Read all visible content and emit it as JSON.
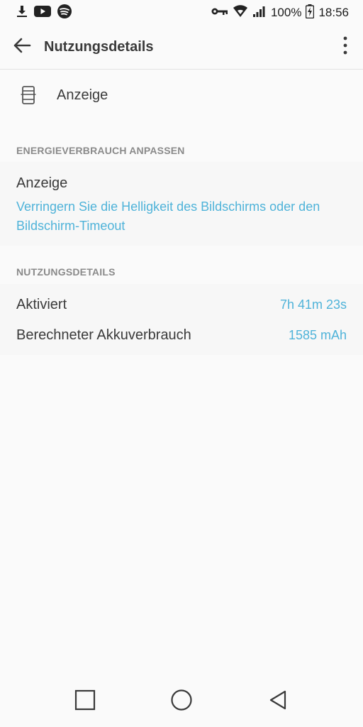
{
  "status_bar": {
    "battery": "100%",
    "time": "18:56",
    "left_icons": [
      "download-icon",
      "youtube-icon",
      "spotify-icon"
    ],
    "right_icons": [
      "vpn-key-icon",
      "wifi-icon",
      "signal-icon",
      "battery-charging-icon"
    ]
  },
  "app_bar": {
    "title": "Nutzungsdetails",
    "back_icon": "arrow-left-icon",
    "menu_icon": "more-vertical-icon"
  },
  "app_entry": {
    "label": "Anzeige",
    "icon": "display-icon"
  },
  "section_adjust": {
    "header": "ENERGIEVERBRAUCH ANPASSEN",
    "item_title": "Anzeige",
    "item_text": "Verringern Sie die Helligkeit des Bildschirms oder den Bildschirm-Timeout"
  },
  "section_usage": {
    "header": "NUTZUNGSDETAILS",
    "rows": [
      {
        "label": "Aktiviert",
        "value": "7h 41m 23s"
      },
      {
        "label": "Berechneter Akkuverbrauch",
        "value": "1585 mAh"
      }
    ]
  },
  "nav_bar": {
    "icons": [
      "recents-square-icon",
      "home-circle-icon",
      "back-triangle-icon"
    ]
  },
  "colors": {
    "accent": "#4fb3d9",
    "background": "#fafafa",
    "section_header": "#8a8a8a"
  }
}
